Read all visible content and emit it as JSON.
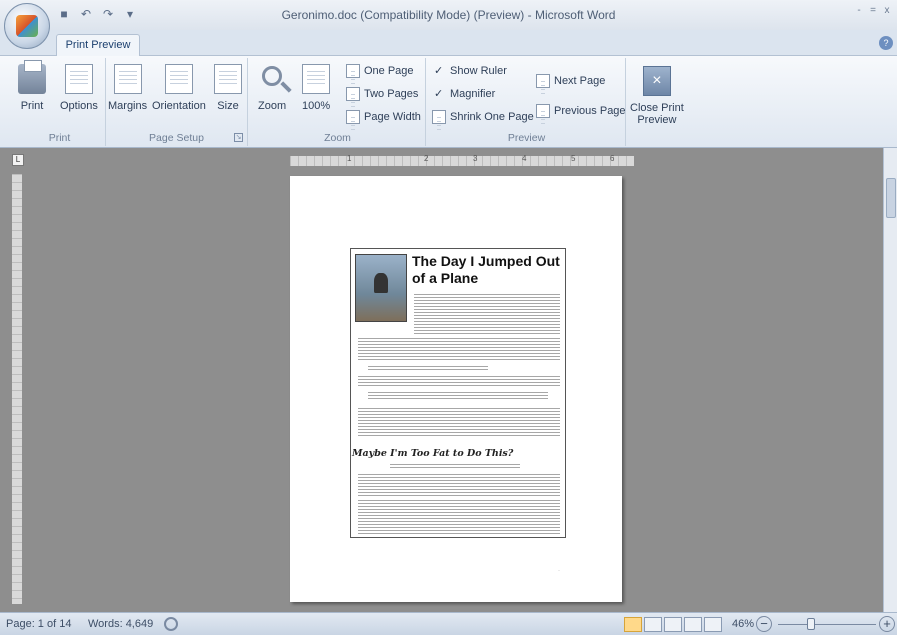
{
  "window": {
    "title": "Geronimo.doc (Compatibility Mode) (Preview) - Microsoft Word",
    "minimize": "-",
    "maximize": "=",
    "close": "x"
  },
  "tabs": {
    "active": "Print Preview"
  },
  "help_icon_glyph": "?",
  "ribbon": {
    "print_group": {
      "label": "Print",
      "print_label": "Print",
      "options_label": "Options"
    },
    "page_setup_group": {
      "label": "Page Setup",
      "margins_label": "Margins",
      "orientation_label": "Orientation",
      "size_label": "Size"
    },
    "zoom_group": {
      "label": "Zoom",
      "zoom_label": "Zoom",
      "hundred_label": "100%",
      "one_page_label": "One Page",
      "two_pages_label": "Two Pages",
      "page_width_label": "Page Width"
    },
    "preview_group": {
      "label": "Preview",
      "show_ruler_label": "Show Ruler",
      "magnifier_label": "Magnifier",
      "shrink_label": "Shrink One Page",
      "next_page_label": "Next Page",
      "previous_page_label": "Previous Page",
      "close_print_preview_line1": "Close Print",
      "close_print_preview_line2": "Preview"
    }
  },
  "ruler": {
    "corner_glyph": "L",
    "marks": [
      "1",
      "2",
      "3",
      "4",
      "5",
      "6"
    ]
  },
  "document": {
    "article_title": "The Day I Jumped Out of a Plane",
    "section_heading": "Maybe I'm Too Fat to Do This?"
  },
  "status": {
    "page": "Page: 1 of 14",
    "words": "Words: 4,649",
    "zoom": "46%",
    "zoom_fraction": 0.32
  },
  "colors": {
    "accent": "#1b3f6e",
    "ribbon_bg": "#dfe7f1",
    "doc_bg": "#8e8e8e"
  }
}
